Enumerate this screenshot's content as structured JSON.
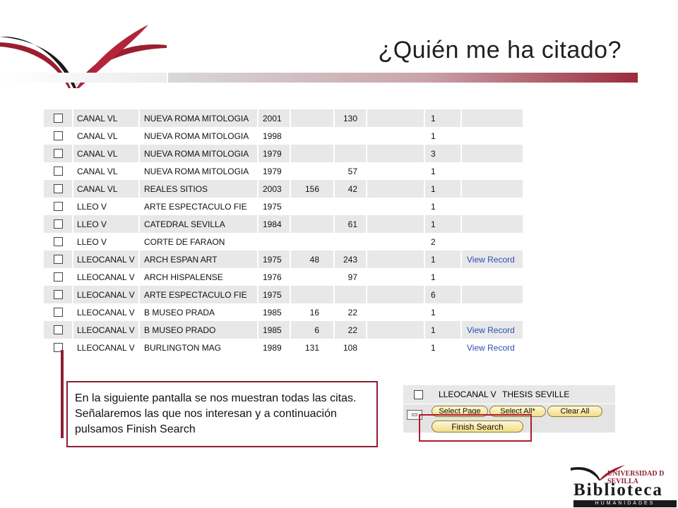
{
  "header": {
    "title": "¿Quién me ha citado?"
  },
  "results": [
    {
      "author": "CANAL VL",
      "source": "NUEVA ROMA MITOLOGIA",
      "year": "2001",
      "volume": "",
      "page": "130",
      "count": "1",
      "link": ""
    },
    {
      "author": "CANAL VL",
      "source": "NUEVA ROMA MITOLOGIA",
      "year": "1998",
      "volume": "",
      "page": "",
      "count": "1",
      "link": ""
    },
    {
      "author": "CANAL VL",
      "source": "NUEVA ROMA MITOLOGIA",
      "year": "1979",
      "volume": "",
      "page": "",
      "count": "3",
      "link": ""
    },
    {
      "author": "CANAL VL",
      "source": "NUEVA ROMA MITOLOGIA",
      "year": "1979",
      "volume": "",
      "page": "57",
      "count": "1",
      "link": ""
    },
    {
      "author": "CANAL VL",
      "source": "REALES SITIOS",
      "year": "2003",
      "volume": "156",
      "page": "42",
      "count": "1",
      "link": ""
    },
    {
      "author": "LLEO V",
      "source": "ARTE ESPECTACULO FIE",
      "year": "1975",
      "volume": "",
      "page": "",
      "count": "1",
      "link": ""
    },
    {
      "author": "LLEO V",
      "source": "CATEDRAL SEVILLA",
      "year": "1984",
      "volume": "",
      "page": "61",
      "count": "1",
      "link": ""
    },
    {
      "author": "LLEO V",
      "source": "CORTE DE FARAON",
      "year": "",
      "volume": "",
      "page": "",
      "count": "2",
      "link": ""
    },
    {
      "author": "LLEOCANAL V",
      "source": "ARCH ESPAN ART",
      "year": "1975",
      "volume": "48",
      "page": "243",
      "count": "1",
      "link": "View Record"
    },
    {
      "author": "LLEOCANAL V",
      "source": "ARCH HISPALENSE",
      "year": "1976",
      "volume": "",
      "page": "97",
      "count": "1",
      "link": ""
    },
    {
      "author": "LLEOCANAL V",
      "source": "ARTE ESPECTACULO FIE",
      "year": "1975",
      "volume": "",
      "page": "",
      "count": "6",
      "link": ""
    },
    {
      "author": "LLEOCANAL V",
      "source": "B MUSEO PRADA",
      "year": "1985",
      "volume": "16",
      "page": "22",
      "count": "1",
      "link": ""
    },
    {
      "author": "LLEOCANAL V",
      "source": "B MUSEO PRADO",
      "year": "1985",
      "volume": "6",
      "page": "22",
      "count": "1",
      "link": "View Record"
    },
    {
      "author": "LLEOCANAL V",
      "source": "BURLINGTON MAG",
      "year": "1989",
      "volume": "131",
      "page": "108",
      "count": "1",
      "link": "View Record"
    }
  ],
  "callout": {
    "text": "En la siguiente pantalla se nos muestran todas las citas. Señalaremos las que nos interesan y a continuación pulsamos Finish Search"
  },
  "extra_row": {
    "author": "LLEOCANAL V",
    "source": "THESIS SEVILLE"
  },
  "buttons": {
    "select_page": "Select Page",
    "select_all": "Select All*",
    "clear_all": "Clear All",
    "finish_search": "Finish Search"
  },
  "logo": {
    "line1": "UNIVERSIDAD D SEVILLA",
    "line2": "Biblioteca",
    "line3": "HUMANIDADES"
  },
  "colors": {
    "brand": "#8c1f33",
    "row_shade": "#e8e8e8",
    "link": "#2b4fb3",
    "button_fill": "#f2dc88"
  }
}
